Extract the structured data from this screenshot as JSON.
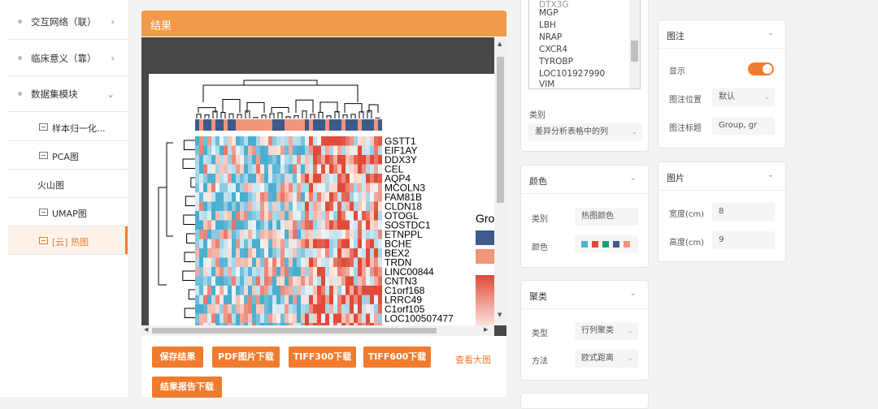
{
  "sidebar": {
    "items": [
      {
        "label": "交互网络（联）",
        "chev": "›"
      },
      {
        "label": "临床意义（靠）",
        "chev": "›"
      },
      {
        "label": "数据集模块",
        "chev": "⌄"
      }
    ],
    "sub_items": [
      {
        "label": "样本归一化..."
      },
      {
        "label": "PCA图"
      },
      {
        "label": "火山图"
      },
      {
        "label": "UMAP图"
      },
      {
        "label": "[云] 热图"
      }
    ]
  },
  "result": {
    "title": "结果",
    "buttons": [
      "保存结果",
      "PDF图片下载",
      "TIFF300下载",
      "TIFF600下载"
    ],
    "report_button": "结果报告下载",
    "view_large": "查看大图"
  },
  "heatmap": {
    "genes": [
      "GSTT1",
      "EIF1AY",
      "DDX3Y",
      "CEL",
      "AQP4",
      "MCOLN3",
      "FAM81B",
      "CLDN18",
      "OTOGL",
      "SOSTDC1",
      "ETNPPL",
      "BCHE",
      "BEX2",
      "TRDN",
      "LINC00844",
      "CNTN3",
      "C1orf168",
      "LRRC49",
      "C1orf105",
      "LOC100507477"
    ],
    "legend_title": "Gro",
    "colors": {
      "group1": "#3d5a8a",
      "group2": "#f0967a",
      "high": "#e04a38",
      "low": "#4aaed0"
    }
  },
  "settings": {
    "genes_list": [
      "MGP",
      "LBH",
      "NRAP",
      "CXCR4",
      "TYROBP",
      "LOC101927990",
      "VIM"
    ],
    "category_label": "类别",
    "category_value": "差异分析表格中的列",
    "color_panel": {
      "title": "颜色",
      "type_label": "类别",
      "type_value": "热图颜色",
      "color_label": "颜色",
      "swatches": [
        "#4ab3d4",
        "#e04a38",
        "#1a9e77",
        "#3d5a8a",
        "#f0967a"
      ]
    },
    "cluster_panel": {
      "title": "聚类",
      "type_label": "类型",
      "type_value": "行列聚类",
      "method_label": "方法",
      "method_value": "欧式距离"
    },
    "legend_panel": {
      "title": "图注",
      "show_label": "显示",
      "position_label": "图注位置",
      "position_value": "默认",
      "title_label": "图注标题",
      "title_value": "Group, gr"
    },
    "image_panel": {
      "title": "图片",
      "width_label": "宽度(cm)",
      "width_value": "8",
      "height_label": "高度(cm)",
      "height_value": "9"
    }
  }
}
